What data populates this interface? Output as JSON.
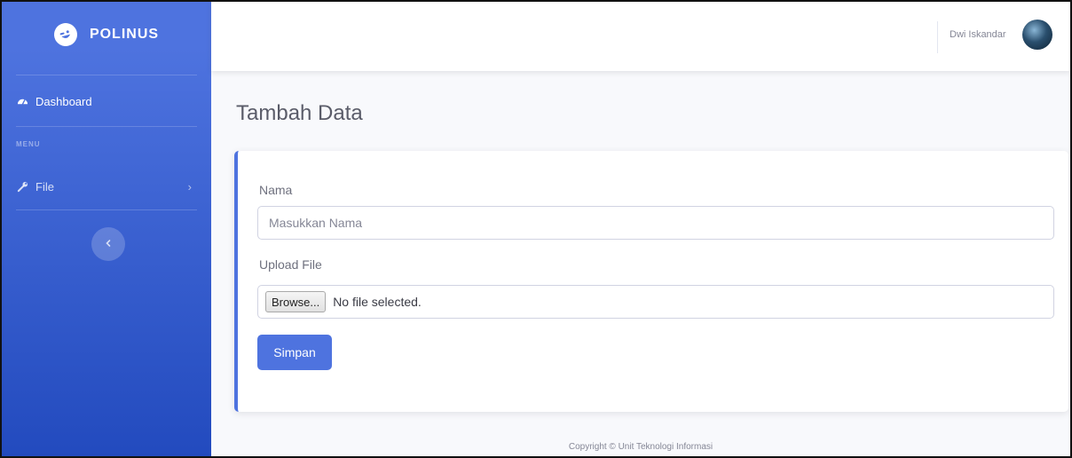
{
  "brand": {
    "name": "POLINUS",
    "icon": "laugh-wink-icon"
  },
  "sidebar": {
    "dashboard_label": "Dashboard",
    "dashboard_icon": "tachometer-icon",
    "menu_heading": "MENU",
    "file_label": "File",
    "file_icon": "wrench-icon",
    "toggle_icon": "chevron-left-icon"
  },
  "topbar": {
    "user_name": "Dwi Iskandar",
    "avatar_icon": "user-avatar"
  },
  "page": {
    "title": "Tambah Data"
  },
  "form": {
    "name_label": "Nama",
    "name_placeholder": "Masukkan Nama",
    "upload_label": "Upload File",
    "browse_label": "Browse...",
    "file_status": "No file selected.",
    "submit_label": "Simpan"
  },
  "footer": {
    "text": "Copyright © Unit Teknologi Informasi"
  },
  "colors": {
    "primary": "#4e73df",
    "primary_dark": "#224abe",
    "text": "#5a5c69"
  }
}
